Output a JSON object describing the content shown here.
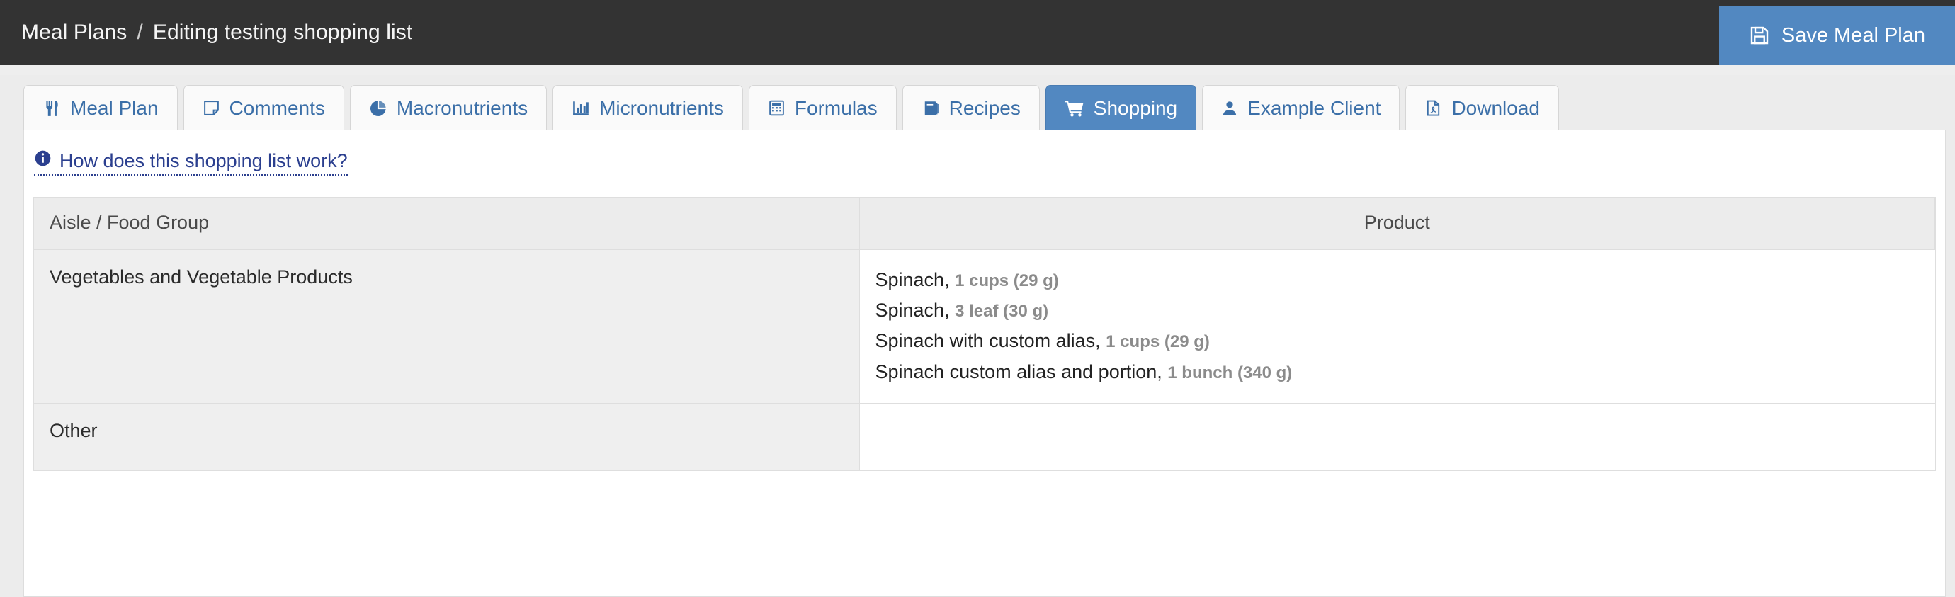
{
  "topbar": {
    "breadcrumb_root": "Meal Plans",
    "breadcrumb_sep": "/",
    "breadcrumb_current": "Editing testing shopping list",
    "save_label": "Save Meal Plan",
    "save_icon": "save-floppy-icon",
    "background_color": "#333333",
    "save_button_color": "#5288c1"
  },
  "tabs": [
    {
      "label": "Meal Plan",
      "icon": "utensils-icon",
      "active": false
    },
    {
      "label": "Comments",
      "icon": "sticky-note-icon",
      "active": false
    },
    {
      "label": "Macronutrients",
      "icon": "pie-chart-icon",
      "active": false
    },
    {
      "label": "Micronutrients",
      "icon": "bar-chart-icon",
      "active": false
    },
    {
      "label": "Formulas",
      "icon": "calculator-icon",
      "active": false
    },
    {
      "label": "Recipes",
      "icon": "book-icon",
      "active": false
    },
    {
      "label": "Shopping",
      "icon": "shopping-cart-icon",
      "active": true
    },
    {
      "label": "Example Client",
      "icon": "user-icon",
      "active": false
    },
    {
      "label": "Download",
      "icon": "file-pdf-icon",
      "active": false
    }
  ],
  "main": {
    "help_link": "How does this shopping list work?",
    "help_icon": "info-circle-icon",
    "link_color": "#2b3f8f",
    "table": {
      "headers": [
        "Aisle / Food Group",
        "Product"
      ],
      "rows": [
        {
          "aisle": "Vegetables and Vegetable Products",
          "products": [
            {
              "name": "Spinach,",
              "portion": "1 cups (29 g)"
            },
            {
              "name": "Spinach,",
              "portion": "3 leaf (30 g)"
            },
            {
              "name": "Spinach with custom alias,",
              "portion": "1 cups (29 g)"
            },
            {
              "name": "Spinach custom alias and portion,",
              "portion": "1 bunch (340 g)"
            }
          ]
        },
        {
          "aisle": "Other",
          "products": []
        }
      ]
    }
  }
}
